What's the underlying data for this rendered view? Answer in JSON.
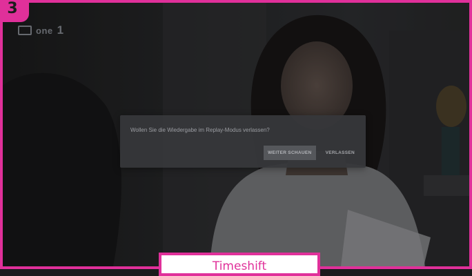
{
  "step_badge": "3",
  "channel": {
    "logo_text": "one",
    "logo_number": "1",
    "logo_icon": "tv-channel-logo-icon"
  },
  "dialog": {
    "message": "Wollen Sie die Wiedergabe im Replay-Modus verlassen?",
    "continue_label": "WEITER SCHAUEN",
    "leave_label": "VERLASSEN"
  },
  "caption": "Timeshift",
  "colors": {
    "accent": "#e0309a",
    "dialog_bg": "#36373a",
    "dialog_text": "#9c9ea3",
    "button_focus_bg": "#55575b"
  }
}
